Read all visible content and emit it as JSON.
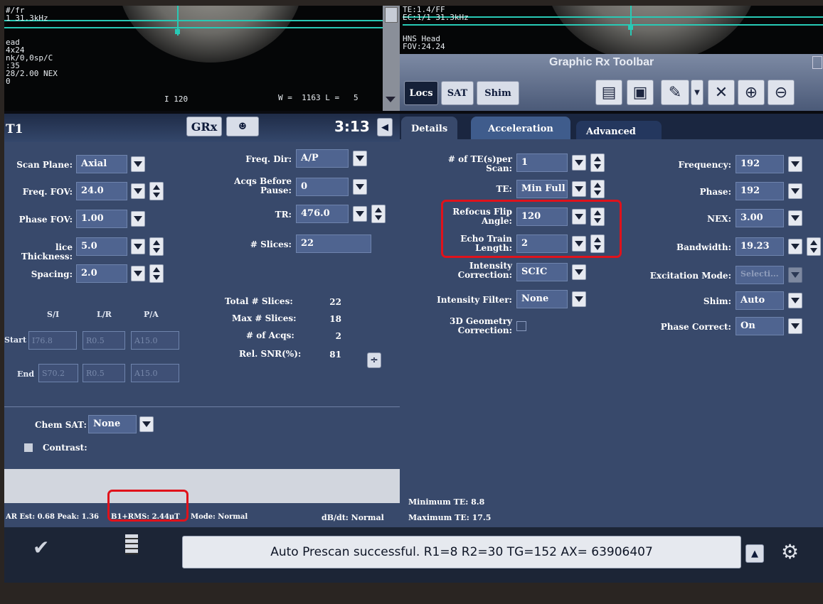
{
  "overlay": {
    "left_lines": [
      "#/fr",
      "1 31.3kHz",
      "",
      "ead",
      "4x24",
      "nk/0,0sp/C",
      ":35",
      "28/2.00 NEX",
      "0"
    ],
    "image_number": "I 120",
    "window_level": "W =  1163 L =   5",
    "right_lines": [
      "TE:1.4/FF",
      "EC:1/1 31.3kHz",
      "",
      "HNS Head",
      "FOV:24.24"
    ]
  },
  "toolbar": {
    "title": "Graphic Rx Toolbar",
    "buttons": [
      "Locs",
      "SAT",
      "Shim"
    ]
  },
  "header": {
    "protocol_title": "T1",
    "grx_label": "GRx",
    "timer": "3:13"
  },
  "tabs": [
    "Details",
    "Acceleration",
    "Advanced"
  ],
  "left": {
    "scan_plane": {
      "label": "Scan Plane:",
      "value": "Axial"
    },
    "freq_fov": {
      "label": "Freq. FOV:",
      "value": "24.0"
    },
    "phase_fov": {
      "label": "Phase FOV:",
      "value": "1.00"
    },
    "slice_thickness": {
      "label": "lice Thickness:",
      "value": "5.0"
    },
    "spacing": {
      "label": "Spacing:",
      "value": "2.0"
    },
    "freq_dir": {
      "label": "Freq. Dir:",
      "value": "A/P"
    },
    "acqs_before_pause": {
      "label": "Acqs Before Pause:",
      "value": "0"
    },
    "tr": {
      "label": "TR:",
      "value": "476.0"
    },
    "slices": {
      "label": "# Slices:",
      "value": "22"
    },
    "coord_headers": [
      "S/I",
      "L/R",
      "P/A"
    ],
    "start": {
      "label": "Start",
      "values": [
        "I76.8",
        "R0.5",
        "A15.0"
      ]
    },
    "end": {
      "label": "End",
      "values": [
        "S70.2",
        "R0.5",
        "A15.0"
      ]
    },
    "stats": [
      {
        "label": "Total # Slices:",
        "value": "22"
      },
      {
        "label": "Max # Slices:",
        "value": "18"
      },
      {
        "label": "# of Acqs:",
        "value": "2"
      },
      {
        "label": "Rel. SNR(%):",
        "value": "81"
      }
    ],
    "chem_sat": {
      "label": "Chem SAT:",
      "value": "None"
    },
    "contrast": {
      "label": "Contrast:"
    },
    "sar_text": "AR Est: 0.68  Peak: 1.36",
    "b1rms": "B1+RMS: 2.44μT",
    "mode": "Mode: Normal",
    "dbdt": "dB/dt: Normal"
  },
  "details": {
    "te_per_scan": {
      "label": "# of TE(s)per Scan:",
      "value": "1"
    },
    "te": {
      "label": "TE:",
      "value": "Min Full"
    },
    "refocus_flip": {
      "label": "Refocus Flip Angle:",
      "value": "120"
    },
    "echo_train": {
      "label": "Echo Train Length:",
      "value": "2"
    },
    "intensity_correction": {
      "label": "Intensity Correction:",
      "value": "SCIC"
    },
    "intensity_filter": {
      "label": "Intensity Filter:",
      "value": "None"
    },
    "geometry": {
      "label": "3D Geometry Correction:"
    },
    "frequency": {
      "label": "Frequency:",
      "value": "192"
    },
    "phase": {
      "label": "Phase:",
      "value": "192"
    },
    "nex": {
      "label": "NEX:",
      "value": "3.00"
    },
    "bandwidth": {
      "label": "Bandwidth:",
      "value": "19.23"
    },
    "excitation": {
      "label": "Excitation Mode:",
      "value": "Selecti..."
    },
    "shim": {
      "label": "Shim:",
      "value": "Auto"
    },
    "phase_correct": {
      "label": "Phase Correct:",
      "value": "On"
    },
    "min_te": "Minimum   TE: 8.8",
    "max_te": "Maximum   TE: 17.5"
  },
  "status": {
    "message": "Auto Prescan successful. R1=8 R2=30 TG=152 AX= 63906407"
  },
  "colors": {
    "panel": "#38496b",
    "highlight": "#e0121b",
    "overlay_line": "#28c9b5"
  }
}
